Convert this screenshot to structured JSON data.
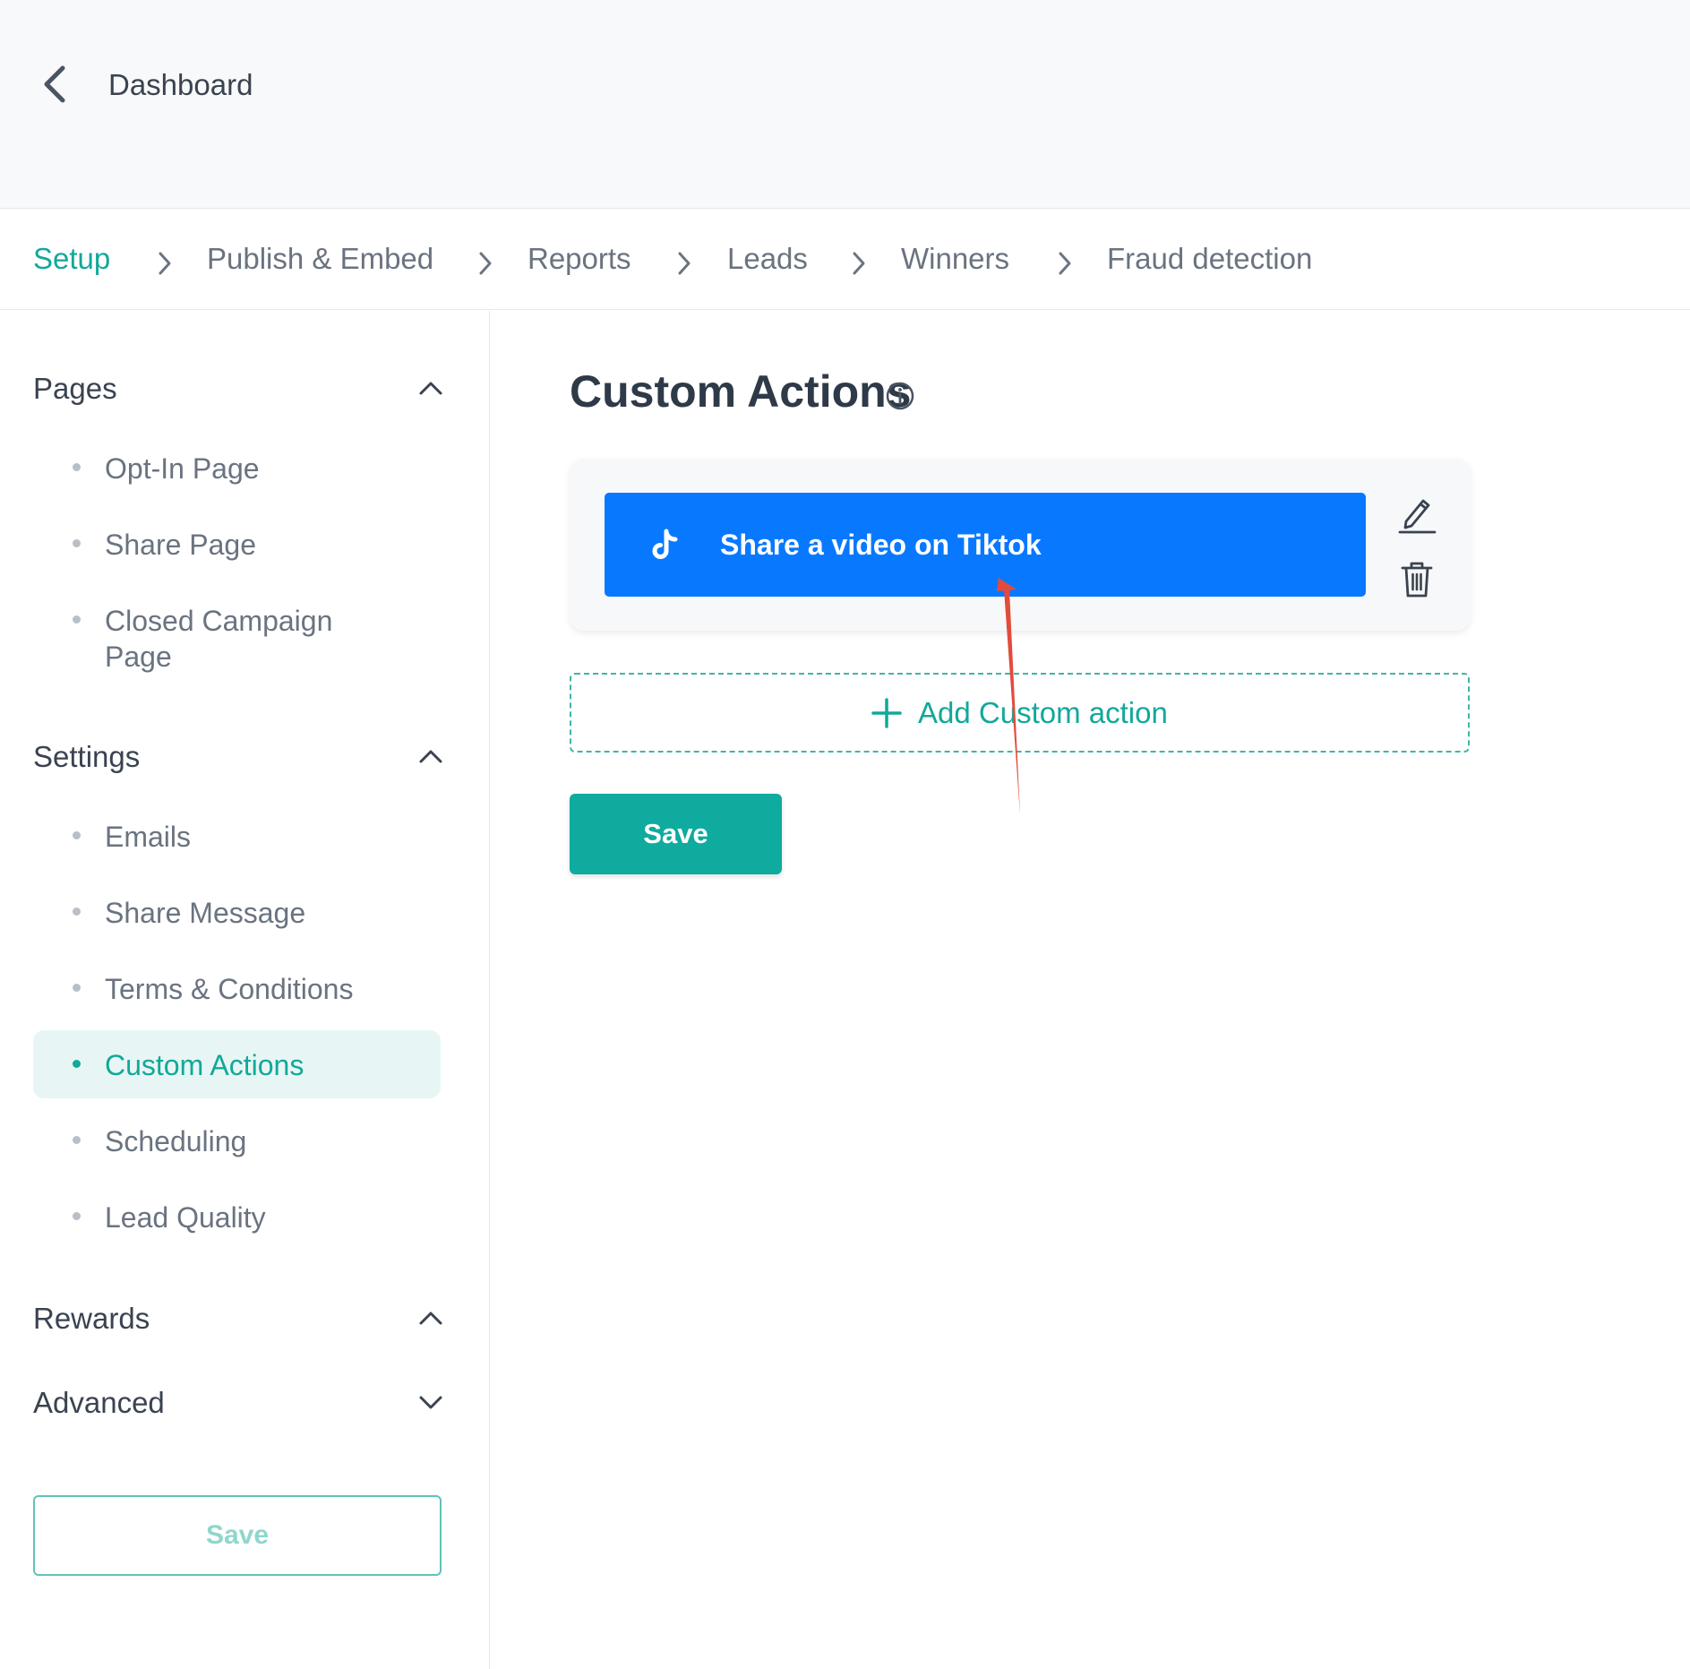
{
  "header": {
    "back_label": "Dashboard",
    "back_icon": "chevron-left-icon"
  },
  "steps": [
    {
      "label": "Setup",
      "active": true
    },
    {
      "label": "Publish & Embed",
      "active": false
    },
    {
      "label": "Reports",
      "active": false
    },
    {
      "label": "Leads",
      "active": false
    },
    {
      "label": "Winners",
      "active": false
    },
    {
      "label": "Fraud detection",
      "active": false
    }
  ],
  "sidebar": {
    "groups": [
      {
        "title": "Pages",
        "expanded": true,
        "items": [
          {
            "label": "Opt-In Page"
          },
          {
            "label": "Share Page"
          },
          {
            "label": "Closed Campaign Page"
          }
        ]
      },
      {
        "title": "Settings",
        "expanded": true,
        "items": [
          {
            "label": "Emails"
          },
          {
            "label": "Share Message"
          },
          {
            "label": "Terms & Conditions"
          },
          {
            "label": "Custom Actions",
            "active": true
          },
          {
            "label": "Scheduling"
          },
          {
            "label": "Lead Quality"
          }
        ]
      },
      {
        "title": "Rewards",
        "expanded": true,
        "items": []
      },
      {
        "title": "Advanced",
        "expanded": false,
        "items": []
      }
    ],
    "save_label": "Save"
  },
  "main": {
    "title": "Custom Actions",
    "actions": [
      {
        "label": "Share a video on Tiktok",
        "icon": "tiktok-icon"
      }
    ],
    "add_label": "Add Custom action",
    "save_label": "Save"
  },
  "colors": {
    "accent": "#12a89a",
    "action_blue": "#0879ff",
    "annotation_red": "#e24b3b"
  }
}
